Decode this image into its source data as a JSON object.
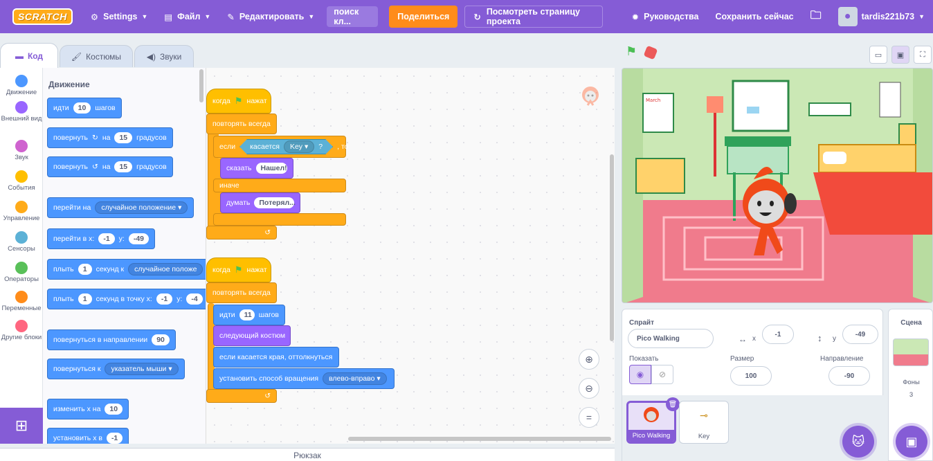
{
  "menu": {
    "logo": "SCRATCH",
    "settings": "Settings",
    "file": "Файл",
    "edit": "Редактировать",
    "search": "поиск кл...",
    "share": "Поделиться",
    "see_project": "Посмотреть страницу проекта",
    "tutorials": "Руководства",
    "save_now": "Сохранить сейчас",
    "username": "tardis221b73"
  },
  "tabs": {
    "code": "Код",
    "costumes": "Костюмы",
    "sounds": "Звуки"
  },
  "categories": [
    {
      "label": "Движение",
      "color": "#4c97ff"
    },
    {
      "label": "Внешний вид",
      "color": "#9966ff"
    },
    {
      "label": "Звук",
      "color": "#cf63cf"
    },
    {
      "label": "События",
      "color": "#ffbf00"
    },
    {
      "label": "Управление",
      "color": "#ffab19"
    },
    {
      "label": "Сенсоры",
      "color": "#5cb1d6"
    },
    {
      "label": "Операторы",
      "color": "#59c059"
    },
    {
      "label": "Переменные",
      "color": "#ff8c1a"
    },
    {
      "label": "Другие блоки",
      "color": "#ff6680"
    }
  ],
  "palette": {
    "title": "Движение",
    "move": {
      "a": "идти",
      "n": "10",
      "b": "шагов"
    },
    "turn_right": {
      "a": "повернуть",
      "icon": "↻",
      "b": "на",
      "n": "15",
      "c": "градусов"
    },
    "turn_left": {
      "a": "повернуть",
      "icon": "↺",
      "b": "на",
      "n": "15",
      "c": "градусов"
    },
    "goto": {
      "a": "перейти на",
      "d": "случайное положение"
    },
    "goto_xy": {
      "a": "перейти в x:",
      "x": "-1",
      "b": "y:",
      "y": "-49"
    },
    "glide": {
      "a": "плыть",
      "n": "1",
      "b": "секунд к",
      "d": "случайное положе"
    },
    "glide_xy": {
      "a": "плыть",
      "n": "1",
      "b": "секунд в точку x:",
      "x": "-1",
      "c": "y:",
      "y": "-4"
    },
    "point_dir": {
      "a": "повернуться в направлении",
      "n": "90"
    },
    "point_to": {
      "a": "повернуться к",
      "d": "указатель мыши"
    },
    "change_x": {
      "a": "изменить х на",
      "n": "10"
    },
    "set_x": {
      "a": "установить х в",
      "n": "-1"
    }
  },
  "script1": {
    "hat": {
      "a": "когда",
      "b": "нажат"
    },
    "forever": "повторять всегда",
    "if": "если",
    "touching": "касается",
    "touch_target": "Key",
    "q": "?",
    "then": ", то",
    "say": "сказать",
    "say_text": "Нашел!",
    "else": "иначе",
    "think": "думать",
    "think_text": "Потерял..."
  },
  "script2": {
    "hat": {
      "a": "когда",
      "b": "нажат"
    },
    "forever": "повторять всегда",
    "move": "идти",
    "move_n": "11",
    "move_b": "шагов",
    "next_costume": "следующий костюм",
    "bounce": "если касается края, оттолкнуться",
    "rotation": "установить способ вращения",
    "rotation_val": "влево-вправо"
  },
  "backpack": "Рюкзак",
  "sprite": {
    "label": "Спрайт",
    "name": "Pico Walking",
    "x_label": "x",
    "x": "-1",
    "y_label": "y",
    "y": "-49",
    "show": "Показать",
    "size_label": "Размер",
    "size": "100",
    "direction_label": "Направление",
    "direction": "-90"
  },
  "sprites": [
    {
      "name": "Pico Walking"
    },
    {
      "name": "Key"
    }
  ],
  "stage_pane": {
    "title": "Сцена",
    "backdrops_label": "Фоны",
    "backdrops": "3"
  },
  "stage_art": {
    "calendar": "March"
  },
  "colors": {
    "accent": "#855cd6",
    "motion": "#4c97ff",
    "control": "#ffab19",
    "events": "#ffbf00",
    "sensing": "#5cb1d6",
    "looks": "#9966ff"
  }
}
